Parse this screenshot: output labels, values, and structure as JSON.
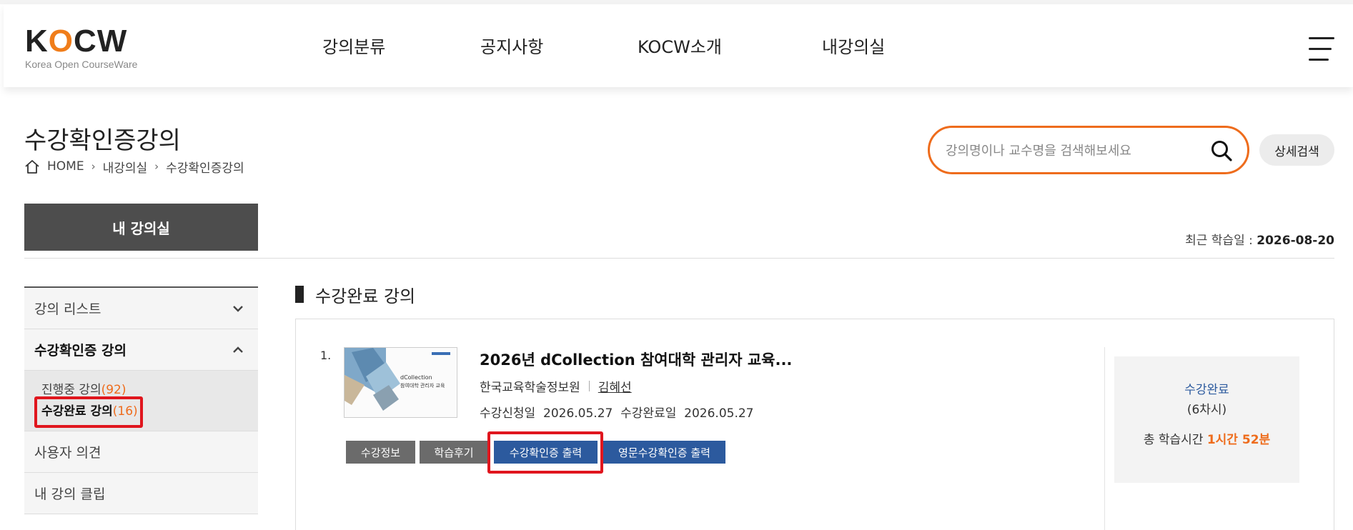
{
  "header": {
    "logo_text": "KOCW",
    "logo_sub": "Korea Open CourseWare",
    "nav": [
      "강의분류",
      "공지사항",
      "KOCW소개",
      "내강의실"
    ]
  },
  "page": {
    "title": "수강확인증강의",
    "breadcrumb": [
      "HOME",
      "내강의실",
      "수강확인증강의"
    ]
  },
  "search": {
    "placeholder": "강의명이나 교수명을 검색해보세요",
    "detail_label": "상세검색"
  },
  "myroom": {
    "label": "내 강의실",
    "recent_label": "최근 학습일 : ",
    "recent_date": "2026-08-20"
  },
  "sidebar": {
    "items": [
      {
        "label": "강의 리스트"
      },
      {
        "label": "수강확인증 강의"
      },
      {
        "label": "사용자 의견"
      },
      {
        "label": "내 강의 클립"
      }
    ],
    "sub_items": [
      {
        "label": "진행중 강의",
        "count": "(92)"
      },
      {
        "label": "수강완료 강의",
        "count": "(16)"
      }
    ]
  },
  "section": {
    "title": "수강완료 강의"
  },
  "course": {
    "number": "1.",
    "title": "2026년 dCollection 참여대학 관리자 교육...",
    "institution": "한국교육학술정보원",
    "professor": "김혜선",
    "dates": "수강신청일  2026.05.27  수강완료일  2026.05.27",
    "thumb_text_1": "dCollection",
    "thumb_text_2": "참여대학 관리자 교육",
    "buttons": {
      "info": "수강정보",
      "review": "학습후기",
      "cert": "수강확인증 출력",
      "cert_en": "영문수강확인증 출력"
    },
    "status": {
      "label": "수강완료",
      "sessions": "(6차시)",
      "time_label": "총 학습시간 ",
      "time_value": "1시간 52분"
    }
  },
  "colors": {
    "accent": "#ee6c1c",
    "button_blue": "#2c5a9e",
    "button_gray": "#6b6b6b",
    "highlight_red": "#e0161e",
    "myroom_bg": "#4d4d4d"
  }
}
